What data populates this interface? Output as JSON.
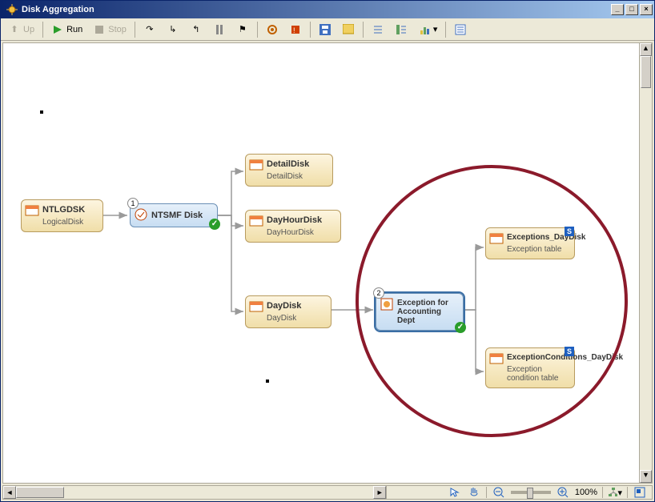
{
  "window": {
    "title": "Disk Aggregation"
  },
  "toolbar": {
    "up": "Up",
    "run": "Run",
    "stop": "Stop"
  },
  "zoom": {
    "value": "100%"
  },
  "nodes": {
    "ntlgdsk": {
      "title": "NTLGDSK",
      "subtitle": "LogicalDisk"
    },
    "ntsmf": {
      "title": "NTSMF Disk",
      "badge": "1"
    },
    "detail": {
      "title": "DetailDisk",
      "subtitle": "DetailDisk"
    },
    "dayhour": {
      "title": "DayHourDisk",
      "subtitle": "DayHourDisk"
    },
    "daydisk": {
      "title": "DayDisk",
      "subtitle": "DayDisk"
    },
    "exception": {
      "title": "Exception for Accounting Dept",
      "badge": "2"
    },
    "exc_day": {
      "title": "Exceptions_DayDisk",
      "subtitle": "Exception table",
      "flag": "S"
    },
    "exc_cond": {
      "title": "ExceptionConditions_DayDisk",
      "subtitle": "Exception condition table",
      "flag": "S"
    }
  }
}
